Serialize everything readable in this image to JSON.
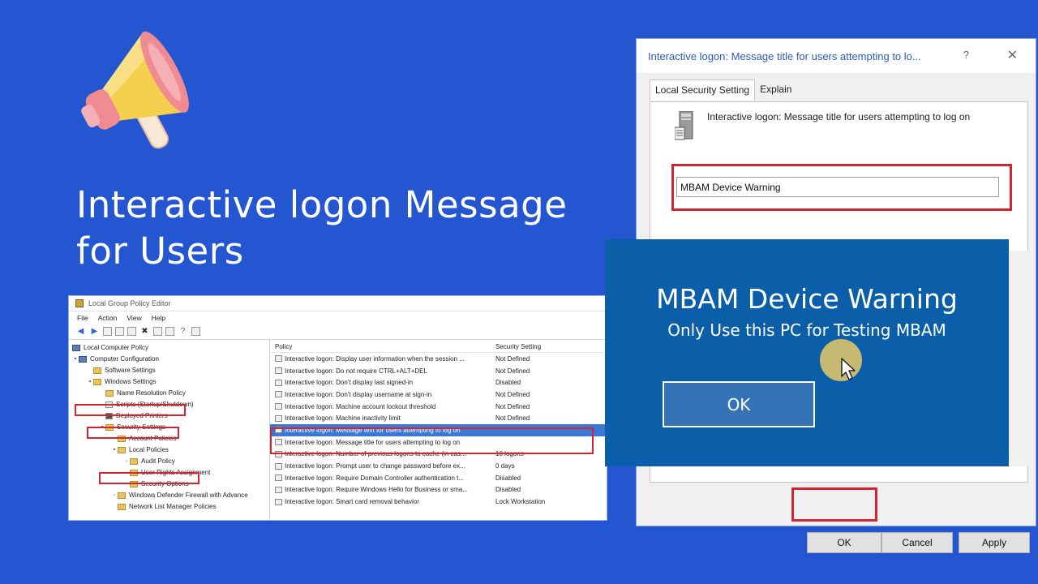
{
  "headline": {
    "line1": "Interactive logon Message",
    "line2": "for Users"
  },
  "colors": {
    "background": "#2456d2",
    "popup": "#0b5fa9",
    "highlight": "#d32531",
    "selection": "#3a78d6"
  },
  "gpe": {
    "title": "Local Group Policy Editor",
    "menu": [
      "File",
      "Action",
      "View",
      "Help"
    ],
    "tree": [
      {
        "label": "Local Computer Policy",
        "icon": "computer-icon"
      },
      {
        "label": "Computer Configuration",
        "icon": "computer-icon"
      },
      {
        "label": "Software Settings",
        "icon": "folder-icon"
      },
      {
        "label": "Windows Settings",
        "icon": "folder-icon"
      },
      {
        "label": "Name Resolution Policy",
        "icon": "folder-icon"
      },
      {
        "label": "Scripts (Startup/Shutdown)",
        "icon": "script-icon"
      },
      {
        "label": "Deployed Printers",
        "icon": "printer-icon"
      },
      {
        "label": "Security Settings",
        "icon": "folder-icon"
      },
      {
        "label": "Account Policies",
        "icon": "folder-icon"
      },
      {
        "label": "Local Policies",
        "icon": "folder-icon"
      },
      {
        "label": "Audit Policy",
        "icon": "folder-icon"
      },
      {
        "label": "User Rights Assignment",
        "icon": "folder-icon"
      },
      {
        "label": "Security Options",
        "icon": "folder-icon"
      },
      {
        "label": "Windows Defender Firewall with Advance",
        "icon": "folder-icon"
      },
      {
        "label": "Network List Manager Policies",
        "icon": "folder-icon"
      }
    ],
    "columns": {
      "policy": "Policy",
      "setting": "Security Setting"
    },
    "rows": [
      {
        "policy": "Interactive logon: Display user information when the session ...",
        "setting": "Not Defined"
      },
      {
        "policy": "Interactive logon: Do not require CTRL+ALT+DEL",
        "setting": "Not Defined"
      },
      {
        "policy": "Interactive logon: Don't display last signed-in",
        "setting": "Disabled"
      },
      {
        "policy": "Interactive logon: Don't display username at sign-in",
        "setting": "Not Defined"
      },
      {
        "policy": "Interactive logon: Machine account lockout threshold",
        "setting": "Not Defined"
      },
      {
        "policy": "Interactive logon: Machine inactivity limit",
        "setting": "Not Defined"
      },
      {
        "policy": "Interactive logon: Message text for users attempting to log on",
        "setting": ""
      },
      {
        "policy": "Interactive logon: Message title for users attempting to log on",
        "setting": ""
      },
      {
        "policy": "Interactive logon: Number of previous logons to cache (in cas...",
        "setting": "10 logons"
      },
      {
        "policy": "Interactive logon: Prompt user to change password before ex...",
        "setting": "0 days"
      },
      {
        "policy": "Interactive logon: Require Domain Controller authentication t...",
        "setting": "Disabled"
      },
      {
        "policy": "Interactive logon: Require Windows Hello for Business or sma...",
        "setting": "Disabled"
      },
      {
        "policy": "Interactive logon: Smart card removal behavior",
        "setting": "Lock Workstation"
      }
    ]
  },
  "dialog": {
    "title": "Interactive logon: Message title for users attempting to lo...",
    "help": "?",
    "close": "✕",
    "tabs": [
      "Local Security Setting",
      "Explain"
    ],
    "description": "Interactive logon: Message title for users attempting to log on",
    "value": "MBAM Device Warning",
    "buttons": {
      "ok": "OK",
      "cancel": "Cancel",
      "apply": "Apply"
    }
  },
  "popup": {
    "title": "MBAM Device Warning",
    "message": "Only Use this PC for Testing MBAM",
    "ok": "OK"
  }
}
